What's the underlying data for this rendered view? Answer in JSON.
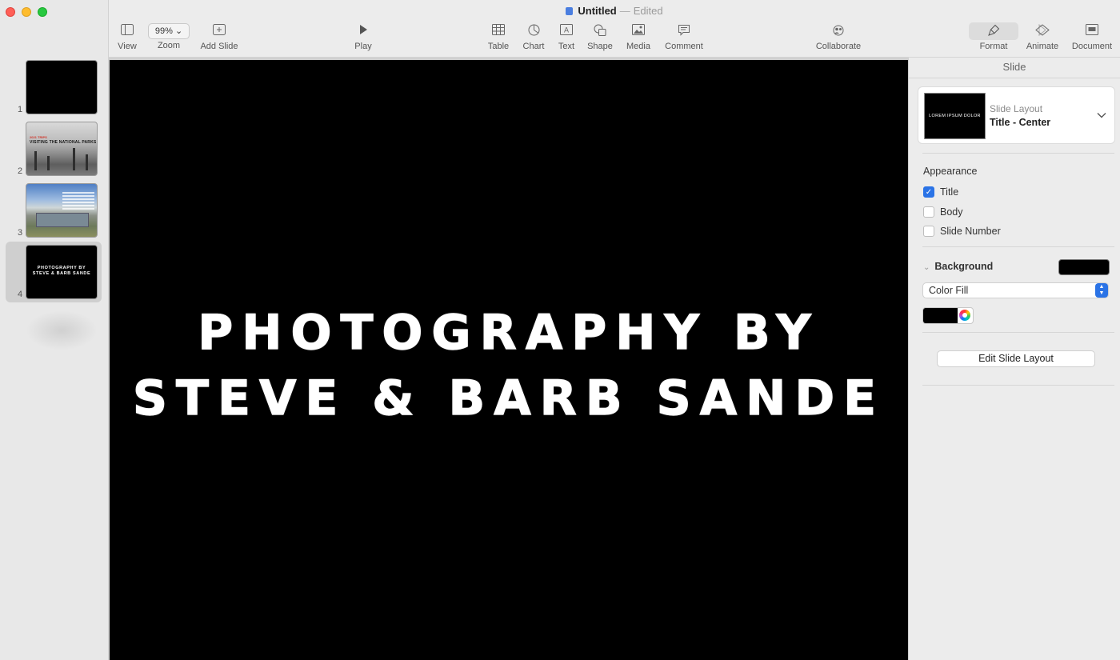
{
  "window": {
    "title": "Untitled",
    "separator": "—",
    "status": "Edited"
  },
  "toolbar": {
    "view": "View",
    "zoom_value": "99%",
    "zoom": "Zoom",
    "add_slide": "Add Slide",
    "play": "Play",
    "table": "Table",
    "chart": "Chart",
    "text": "Text",
    "shape": "Shape",
    "media": "Media",
    "comment": "Comment",
    "collaborate": "Collaborate",
    "format": "Format",
    "animate": "Animate",
    "document": "Document"
  },
  "slides": [
    {
      "number": "1"
    },
    {
      "number": "2",
      "red_text": "2021 TRIPS",
      "text": "VISITING THE NATIONAL PARKS"
    },
    {
      "number": "3"
    },
    {
      "number": "4",
      "text_line1": "PHOTOGRAPHY BY",
      "text_line2": "STEVE & BARB SANDE",
      "selected": true
    }
  ],
  "canvas": {
    "title_line1": "PHOTOGRAPHY BY",
    "title_line2": "STEVE & BARB SANDE",
    "background": "#000000",
    "text_color": "#ffffff"
  },
  "inspector": {
    "header": "Slide",
    "layout_thumb_text": "LOREM IPSUM DOLOR",
    "layout_label": "Slide Layout",
    "layout_value": "Title - Center",
    "appearance_title": "Appearance",
    "checkboxes": [
      {
        "label": "Title",
        "checked": true
      },
      {
        "label": "Body",
        "checked": false
      },
      {
        "label": "Slide Number",
        "checked": false
      }
    ],
    "background_title": "Background",
    "background_color": "#000000",
    "fill_type": "Color Fill",
    "edit_layout_button": "Edit Slide Layout"
  },
  "colors": {
    "accent": "#2a73e6",
    "close": "#ff5f57",
    "minimize": "#febc2e",
    "zoom": "#28c840"
  }
}
